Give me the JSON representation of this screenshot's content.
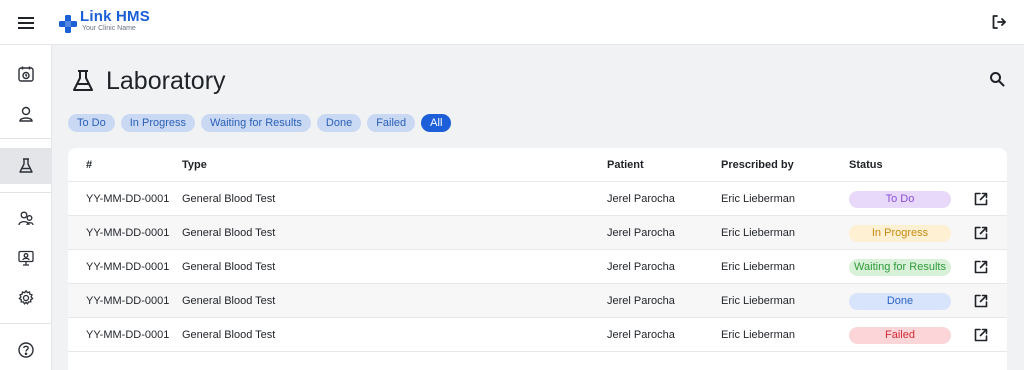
{
  "brand": {
    "title": "Link HMS",
    "subtitle": "Your Clinic Name",
    "color": "#1a5fd6"
  },
  "header": {
    "menu_icon": "hamburger-menu-icon",
    "logout_icon": "logout-icon"
  },
  "sidebar": {
    "items": [
      {
        "icon": "calendar-icon",
        "active": false
      },
      {
        "icon": "user-icon",
        "active": false
      },
      {
        "icon": "flask-icon",
        "active": true
      },
      {
        "icon": "users-icon",
        "active": false
      },
      {
        "icon": "monitor-user-icon",
        "active": false
      },
      {
        "icon": "gear-icon",
        "active": false
      },
      {
        "icon": "help-circle-icon",
        "active": false
      }
    ]
  },
  "page": {
    "title": "Laboratory",
    "title_icon": "flask-icon",
    "search_icon": "search-icon"
  },
  "filters": [
    {
      "label": "To Do",
      "active": false
    },
    {
      "label": "In Progress",
      "active": false
    },
    {
      "label": "Waiting for Results",
      "active": false
    },
    {
      "label": "Done",
      "active": false
    },
    {
      "label": "Failed",
      "active": false
    },
    {
      "label": "All",
      "active": true
    }
  ],
  "table": {
    "columns": {
      "id": "#",
      "type": "Type",
      "patient": "Patient",
      "prescribed_by": "Prescribed by",
      "status": "Status"
    },
    "rows": [
      {
        "id": "YY-MM-DD-0001",
        "type": "General Blood Test",
        "patient": "Jerel Parocha",
        "prescribed_by": "Eric Lieberman",
        "status": "To Do"
      },
      {
        "id": "YY-MM-DD-0001",
        "type": "General Blood Test",
        "patient": "Jerel Parocha",
        "prescribed_by": "Eric Lieberman",
        "status": "In Progress"
      },
      {
        "id": "YY-MM-DD-0001",
        "type": "General Blood Test",
        "patient": "Jerel Parocha",
        "prescribed_by": "Eric Lieberman",
        "status": "Waiting for Results"
      },
      {
        "id": "YY-MM-DD-0001",
        "type": "General Blood Test",
        "patient": "Jerel Parocha",
        "prescribed_by": "Eric Lieberman",
        "status": "Done"
      },
      {
        "id": "YY-MM-DD-0001",
        "type": "General Blood Test",
        "patient": "Jerel Parocha",
        "prescribed_by": "Eric Lieberman",
        "status": "Failed"
      }
    ],
    "row_action_icon": "open-external-icon"
  },
  "status_colors": {
    "To Do": {
      "bg": "#e8d9fb",
      "fg": "#8a4fd6"
    },
    "In Progress": {
      "bg": "#fdf0d3",
      "fg": "#c98a10"
    },
    "Waiting for Results": {
      "bg": "#d8f1d8",
      "fg": "#2f9a3a"
    },
    "Done": {
      "bg": "#d7e4fb",
      "fg": "#2b63c8"
    },
    "Failed": {
      "bg": "#fbd5d7",
      "fg": "#d22a35"
    }
  }
}
